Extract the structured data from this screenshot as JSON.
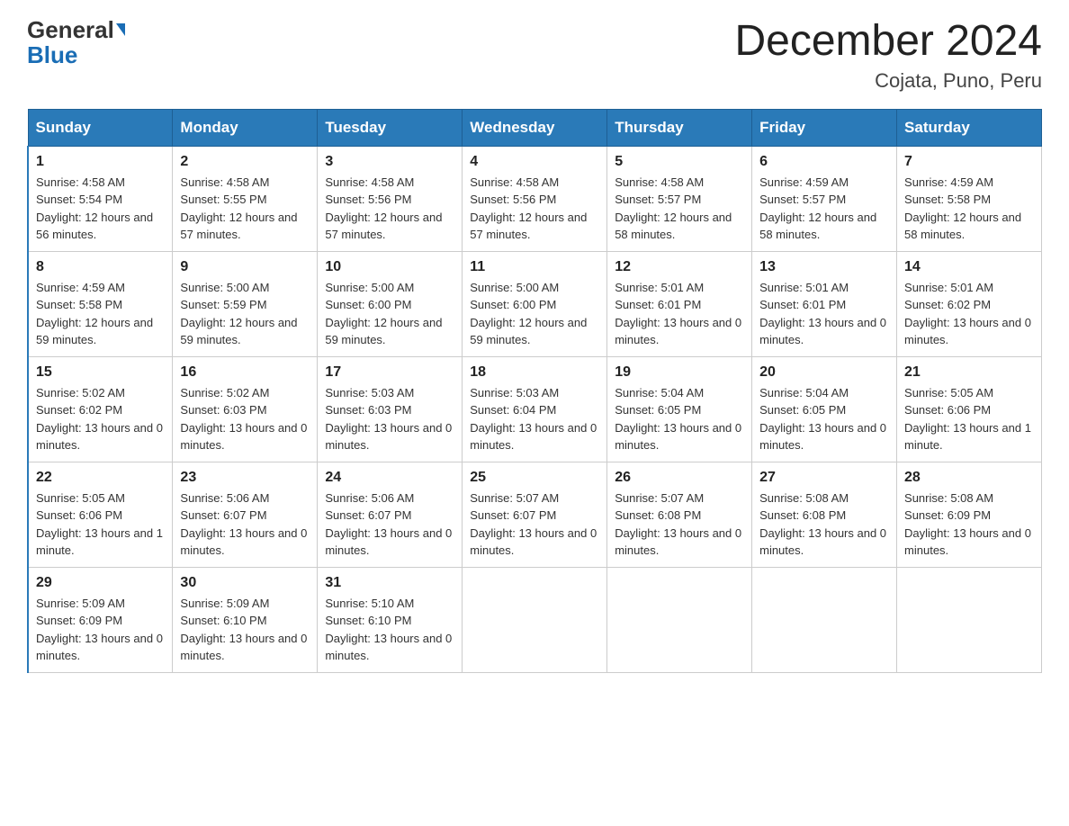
{
  "header": {
    "logo_general": "General",
    "logo_blue": "Blue",
    "month_title": "December 2024",
    "location": "Cojata, Puno, Peru"
  },
  "columns": [
    "Sunday",
    "Monday",
    "Tuesday",
    "Wednesday",
    "Thursday",
    "Friday",
    "Saturday"
  ],
  "weeks": [
    [
      {
        "day": "1",
        "sunrise": "4:58 AM",
        "sunset": "5:54 PM",
        "daylight": "12 hours and 56 minutes."
      },
      {
        "day": "2",
        "sunrise": "4:58 AM",
        "sunset": "5:55 PM",
        "daylight": "12 hours and 57 minutes."
      },
      {
        "day": "3",
        "sunrise": "4:58 AM",
        "sunset": "5:56 PM",
        "daylight": "12 hours and 57 minutes."
      },
      {
        "day": "4",
        "sunrise": "4:58 AM",
        "sunset": "5:56 PM",
        "daylight": "12 hours and 57 minutes."
      },
      {
        "day": "5",
        "sunrise": "4:58 AM",
        "sunset": "5:57 PM",
        "daylight": "12 hours and 58 minutes."
      },
      {
        "day": "6",
        "sunrise": "4:59 AM",
        "sunset": "5:57 PM",
        "daylight": "12 hours and 58 minutes."
      },
      {
        "day": "7",
        "sunrise": "4:59 AM",
        "sunset": "5:58 PM",
        "daylight": "12 hours and 58 minutes."
      }
    ],
    [
      {
        "day": "8",
        "sunrise": "4:59 AM",
        "sunset": "5:58 PM",
        "daylight": "12 hours and 59 minutes."
      },
      {
        "day": "9",
        "sunrise": "5:00 AM",
        "sunset": "5:59 PM",
        "daylight": "12 hours and 59 minutes."
      },
      {
        "day": "10",
        "sunrise": "5:00 AM",
        "sunset": "6:00 PM",
        "daylight": "12 hours and 59 minutes."
      },
      {
        "day": "11",
        "sunrise": "5:00 AM",
        "sunset": "6:00 PM",
        "daylight": "12 hours and 59 minutes."
      },
      {
        "day": "12",
        "sunrise": "5:01 AM",
        "sunset": "6:01 PM",
        "daylight": "13 hours and 0 minutes."
      },
      {
        "day": "13",
        "sunrise": "5:01 AM",
        "sunset": "6:01 PM",
        "daylight": "13 hours and 0 minutes."
      },
      {
        "day": "14",
        "sunrise": "5:01 AM",
        "sunset": "6:02 PM",
        "daylight": "13 hours and 0 minutes."
      }
    ],
    [
      {
        "day": "15",
        "sunrise": "5:02 AM",
        "sunset": "6:02 PM",
        "daylight": "13 hours and 0 minutes."
      },
      {
        "day": "16",
        "sunrise": "5:02 AM",
        "sunset": "6:03 PM",
        "daylight": "13 hours and 0 minutes."
      },
      {
        "day": "17",
        "sunrise": "5:03 AM",
        "sunset": "6:03 PM",
        "daylight": "13 hours and 0 minutes."
      },
      {
        "day": "18",
        "sunrise": "5:03 AM",
        "sunset": "6:04 PM",
        "daylight": "13 hours and 0 minutes."
      },
      {
        "day": "19",
        "sunrise": "5:04 AM",
        "sunset": "6:05 PM",
        "daylight": "13 hours and 0 minutes."
      },
      {
        "day": "20",
        "sunrise": "5:04 AM",
        "sunset": "6:05 PM",
        "daylight": "13 hours and 0 minutes."
      },
      {
        "day": "21",
        "sunrise": "5:05 AM",
        "sunset": "6:06 PM",
        "daylight": "13 hours and 1 minute."
      }
    ],
    [
      {
        "day": "22",
        "sunrise": "5:05 AM",
        "sunset": "6:06 PM",
        "daylight": "13 hours and 1 minute."
      },
      {
        "day": "23",
        "sunrise": "5:06 AM",
        "sunset": "6:07 PM",
        "daylight": "13 hours and 0 minutes."
      },
      {
        "day": "24",
        "sunrise": "5:06 AM",
        "sunset": "6:07 PM",
        "daylight": "13 hours and 0 minutes."
      },
      {
        "day": "25",
        "sunrise": "5:07 AM",
        "sunset": "6:07 PM",
        "daylight": "13 hours and 0 minutes."
      },
      {
        "day": "26",
        "sunrise": "5:07 AM",
        "sunset": "6:08 PM",
        "daylight": "13 hours and 0 minutes."
      },
      {
        "day": "27",
        "sunrise": "5:08 AM",
        "sunset": "6:08 PM",
        "daylight": "13 hours and 0 minutes."
      },
      {
        "day": "28",
        "sunrise": "5:08 AM",
        "sunset": "6:09 PM",
        "daylight": "13 hours and 0 minutes."
      }
    ],
    [
      {
        "day": "29",
        "sunrise": "5:09 AM",
        "sunset": "6:09 PM",
        "daylight": "13 hours and 0 minutes."
      },
      {
        "day": "30",
        "sunrise": "5:09 AM",
        "sunset": "6:10 PM",
        "daylight": "13 hours and 0 minutes."
      },
      {
        "day": "31",
        "sunrise": "5:10 AM",
        "sunset": "6:10 PM",
        "daylight": "13 hours and 0 minutes."
      },
      null,
      null,
      null,
      null
    ]
  ],
  "labels": {
    "sunrise": "Sunrise:",
    "sunset": "Sunset:",
    "daylight": "Daylight:"
  }
}
